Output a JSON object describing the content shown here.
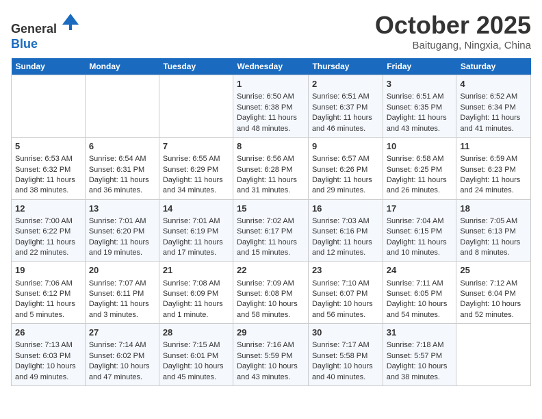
{
  "header": {
    "logo_line1": "General",
    "logo_line2": "Blue",
    "month": "October 2025",
    "location": "Baitugang, Ningxia, China"
  },
  "weekdays": [
    "Sunday",
    "Monday",
    "Tuesday",
    "Wednesday",
    "Thursday",
    "Friday",
    "Saturday"
  ],
  "weeks": [
    [
      {
        "day": "",
        "text": ""
      },
      {
        "day": "",
        "text": ""
      },
      {
        "day": "",
        "text": ""
      },
      {
        "day": "1",
        "text": "Sunrise: 6:50 AM\nSunset: 6:38 PM\nDaylight: 11 hours and 48 minutes."
      },
      {
        "day": "2",
        "text": "Sunrise: 6:51 AM\nSunset: 6:37 PM\nDaylight: 11 hours and 46 minutes."
      },
      {
        "day": "3",
        "text": "Sunrise: 6:51 AM\nSunset: 6:35 PM\nDaylight: 11 hours and 43 minutes."
      },
      {
        "day": "4",
        "text": "Sunrise: 6:52 AM\nSunset: 6:34 PM\nDaylight: 11 hours and 41 minutes."
      }
    ],
    [
      {
        "day": "5",
        "text": "Sunrise: 6:53 AM\nSunset: 6:32 PM\nDaylight: 11 hours and 38 minutes."
      },
      {
        "day": "6",
        "text": "Sunrise: 6:54 AM\nSunset: 6:31 PM\nDaylight: 11 hours and 36 minutes."
      },
      {
        "day": "7",
        "text": "Sunrise: 6:55 AM\nSunset: 6:29 PM\nDaylight: 11 hours and 34 minutes."
      },
      {
        "day": "8",
        "text": "Sunrise: 6:56 AM\nSunset: 6:28 PM\nDaylight: 11 hours and 31 minutes."
      },
      {
        "day": "9",
        "text": "Sunrise: 6:57 AM\nSunset: 6:26 PM\nDaylight: 11 hours and 29 minutes."
      },
      {
        "day": "10",
        "text": "Sunrise: 6:58 AM\nSunset: 6:25 PM\nDaylight: 11 hours and 26 minutes."
      },
      {
        "day": "11",
        "text": "Sunrise: 6:59 AM\nSunset: 6:23 PM\nDaylight: 11 hours and 24 minutes."
      }
    ],
    [
      {
        "day": "12",
        "text": "Sunrise: 7:00 AM\nSunset: 6:22 PM\nDaylight: 11 hours and 22 minutes."
      },
      {
        "day": "13",
        "text": "Sunrise: 7:01 AM\nSunset: 6:20 PM\nDaylight: 11 hours and 19 minutes."
      },
      {
        "day": "14",
        "text": "Sunrise: 7:01 AM\nSunset: 6:19 PM\nDaylight: 11 hours and 17 minutes."
      },
      {
        "day": "15",
        "text": "Sunrise: 7:02 AM\nSunset: 6:17 PM\nDaylight: 11 hours and 15 minutes."
      },
      {
        "day": "16",
        "text": "Sunrise: 7:03 AM\nSunset: 6:16 PM\nDaylight: 11 hours and 12 minutes."
      },
      {
        "day": "17",
        "text": "Sunrise: 7:04 AM\nSunset: 6:15 PM\nDaylight: 11 hours and 10 minutes."
      },
      {
        "day": "18",
        "text": "Sunrise: 7:05 AM\nSunset: 6:13 PM\nDaylight: 11 hours and 8 minutes."
      }
    ],
    [
      {
        "day": "19",
        "text": "Sunrise: 7:06 AM\nSunset: 6:12 PM\nDaylight: 11 hours and 5 minutes."
      },
      {
        "day": "20",
        "text": "Sunrise: 7:07 AM\nSunset: 6:11 PM\nDaylight: 11 hours and 3 minutes."
      },
      {
        "day": "21",
        "text": "Sunrise: 7:08 AM\nSunset: 6:09 PM\nDaylight: 11 hours and 1 minute."
      },
      {
        "day": "22",
        "text": "Sunrise: 7:09 AM\nSunset: 6:08 PM\nDaylight: 10 hours and 58 minutes."
      },
      {
        "day": "23",
        "text": "Sunrise: 7:10 AM\nSunset: 6:07 PM\nDaylight: 10 hours and 56 minutes."
      },
      {
        "day": "24",
        "text": "Sunrise: 7:11 AM\nSunset: 6:05 PM\nDaylight: 10 hours and 54 minutes."
      },
      {
        "day": "25",
        "text": "Sunrise: 7:12 AM\nSunset: 6:04 PM\nDaylight: 10 hours and 52 minutes."
      }
    ],
    [
      {
        "day": "26",
        "text": "Sunrise: 7:13 AM\nSunset: 6:03 PM\nDaylight: 10 hours and 49 minutes."
      },
      {
        "day": "27",
        "text": "Sunrise: 7:14 AM\nSunset: 6:02 PM\nDaylight: 10 hours and 47 minutes."
      },
      {
        "day": "28",
        "text": "Sunrise: 7:15 AM\nSunset: 6:01 PM\nDaylight: 10 hours and 45 minutes."
      },
      {
        "day": "29",
        "text": "Sunrise: 7:16 AM\nSunset: 5:59 PM\nDaylight: 10 hours and 43 minutes."
      },
      {
        "day": "30",
        "text": "Sunrise: 7:17 AM\nSunset: 5:58 PM\nDaylight: 10 hours and 40 minutes."
      },
      {
        "day": "31",
        "text": "Sunrise: 7:18 AM\nSunset: 5:57 PM\nDaylight: 10 hours and 38 minutes."
      },
      {
        "day": "",
        "text": ""
      }
    ]
  ]
}
